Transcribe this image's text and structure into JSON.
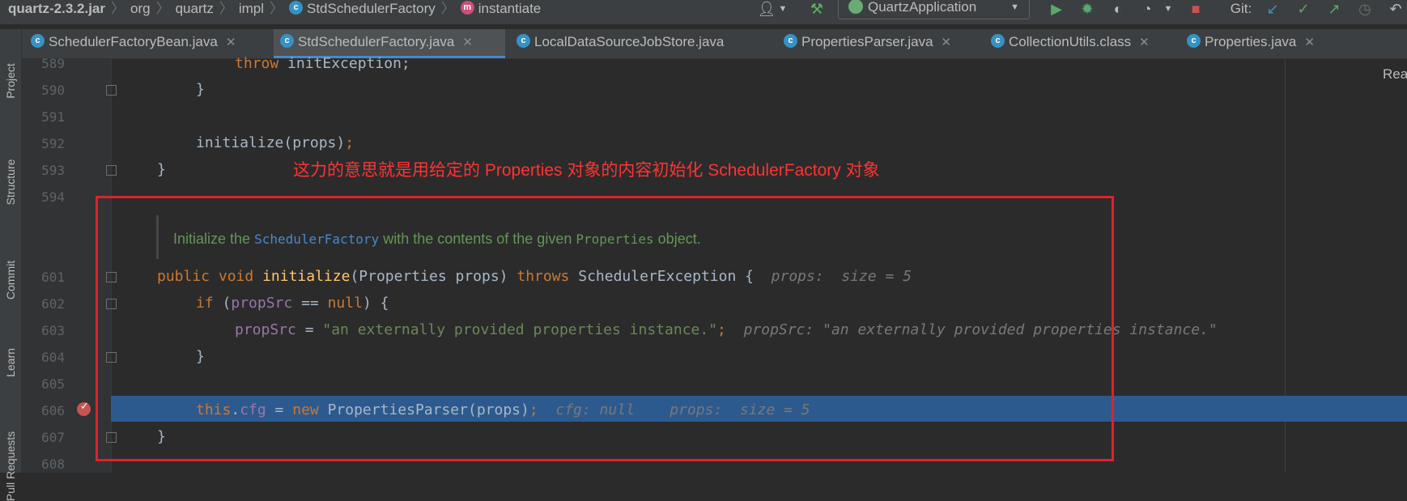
{
  "breadcrumbs": {
    "jar": "quartz-2.3.2.jar",
    "pkg1": "org",
    "pkg2": "quartz",
    "pkg3": "impl",
    "cls": "StdSchedulerFactory",
    "method": "instantiate"
  },
  "toolbar": {
    "run_config": "QuartzApplication",
    "git_label": "Git:"
  },
  "tabs": [
    {
      "label": "SchedulerFactoryBean.java",
      "active": false
    },
    {
      "label": "StdSchedulerFactory.java",
      "active": true
    },
    {
      "label": "LocalDataSourceJobStore.java",
      "active": false
    },
    {
      "label": "PropertiesParser.java",
      "active": false
    },
    {
      "label": "CollectionUtils.class",
      "active": false
    },
    {
      "label": "Properties.java",
      "active": false
    }
  ],
  "tool_windows": [
    "Project",
    "Structure",
    "Commit",
    "Learn",
    "Pull Requests"
  ],
  "reader_mode_label": "Rea",
  "annotation_note": "这力的意思就是用给定的 Properties 对象的内容初始化 SchedulerFactory 对象",
  "javadoc": {
    "part1": "Initialize the ",
    "ref1": "SchedulerFactory",
    "part2": " with the contents of the given ",
    "ref2": "Properties",
    "part3": " object."
  },
  "line_numbers": [
    "589",
    "590",
    "591",
    "592",
    "593",
    "594",
    "601",
    "602",
    "603",
    "604",
    "605",
    "606",
    "607",
    "608"
  ],
  "code": {
    "l589_kw": "throw",
    "l589_rest": " initException;",
    "l590": "}",
    "l592_call": "initialize(props)",
    "l592_semi": ";",
    "l593": "}",
    "l601_kw1": "public",
    "l601_kw2": "void",
    "l601_fn": "initialize",
    "l601_params": "(Properties props)",
    "l601_kw3": "throws",
    "l601_rest": " SchedulerException {",
    "l601_hint": "props:  size = 5",
    "l602_kw": "if",
    "l602_open": " (",
    "l602_fld": "propSrc",
    "l602_op": " == ",
    "l602_null": "null",
    "l602_close": ") {",
    "l603_fld": "propSrc",
    "l603_eq": " = ",
    "l603_str": "\"an externally provided properties instance.\"",
    "l603_semi": ";",
    "l603_hint": "propSrc: \"an externally provided properties instance.\"",
    "l604": "}",
    "l606_this": "this",
    "l606_dot": ".",
    "l606_fld": "cfg",
    "l606_eq": " = ",
    "l606_new": "new",
    "l606_rest": " PropertiesParser(props)",
    "l606_semi": ";",
    "l606_hint": "cfg: null    props:  size = 5",
    "l607": "}"
  }
}
